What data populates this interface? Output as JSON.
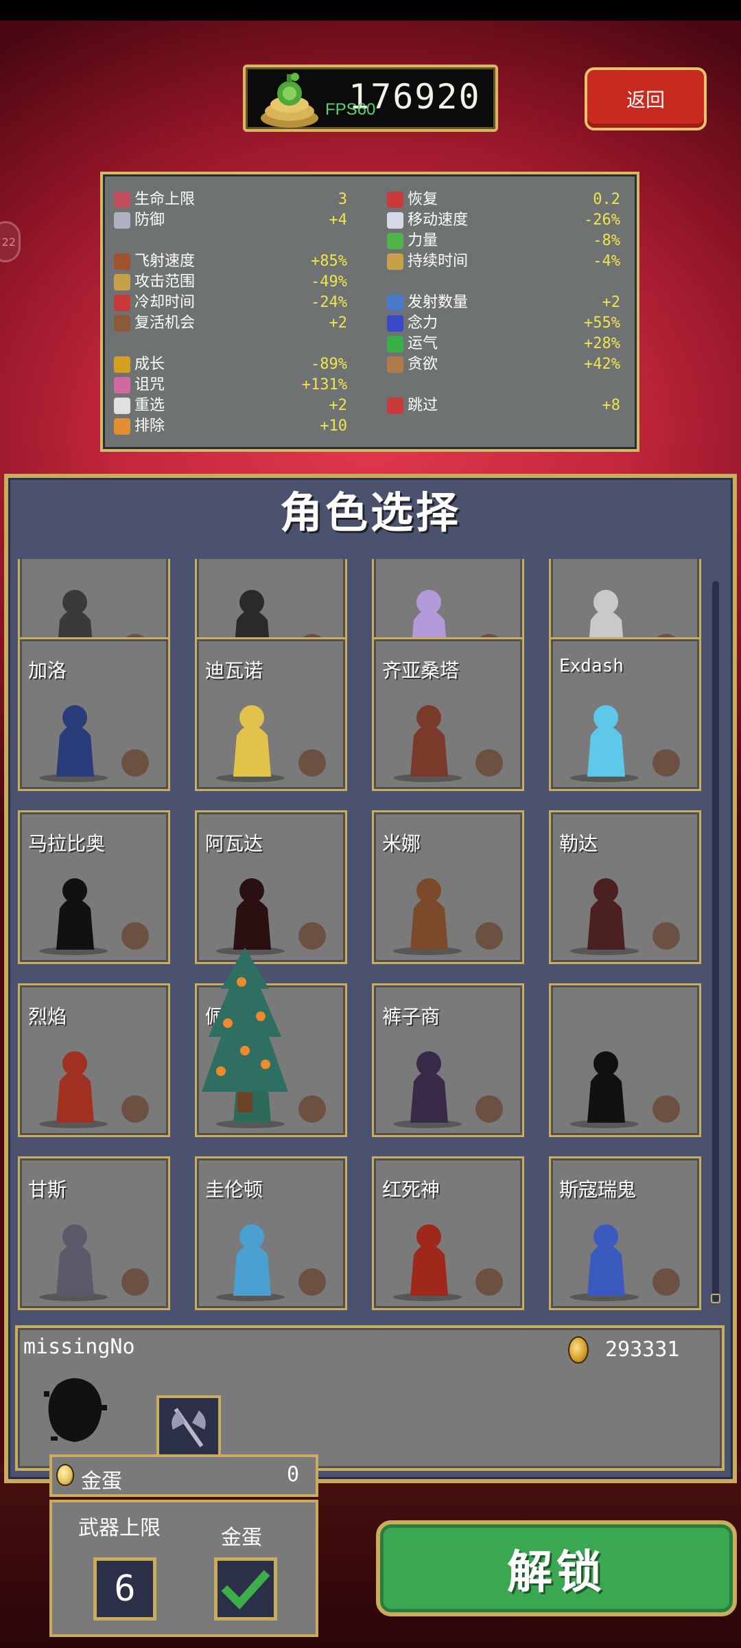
{
  "header": {
    "coins": "176920",
    "fps": "FPS60",
    "back_label": "返回",
    "side_tab": "22"
  },
  "stats": {
    "left": [
      {
        "label": "生命上限",
        "value": "3",
        "icon": "heart-icon"
      },
      {
        "label": "防御",
        "value": "+4",
        "icon": "armor-icon"
      },
      {
        "label": "飞射速度",
        "value": "+85%",
        "icon": "speed-icon"
      },
      {
        "label": "攻击范围",
        "value": "-49%",
        "icon": "area-icon"
      },
      {
        "label": "冷却时间",
        "value": "-24%",
        "icon": "cooldown-icon"
      },
      {
        "label": "复活机会",
        "value": "+2",
        "icon": "revival-icon"
      },
      {
        "label": "成长",
        "value": "-89%",
        "icon": "growth-icon"
      },
      {
        "label": "诅咒",
        "value": "+131%",
        "icon": "curse-icon"
      },
      {
        "label": "重选",
        "value": "+2",
        "icon": "reroll-icon"
      },
      {
        "label": "排除",
        "value": "+10",
        "icon": "banish-icon"
      }
    ],
    "right": [
      {
        "label": "恢复",
        "value": "0.2",
        "icon": "recovery-icon"
      },
      {
        "label": "移动速度",
        "value": "-26%",
        "icon": "wing-icon"
      },
      {
        "label": "力量",
        "value": "-8%",
        "icon": "might-icon"
      },
      {
        "label": "持续时间",
        "value": "-4%",
        "icon": "duration-icon"
      },
      {
        "label": "发射数量",
        "value": "+2",
        "icon": "amount-icon"
      },
      {
        "label": "念力",
        "value": "+55%",
        "icon": "magnet-icon"
      },
      {
        "label": "运气",
        "value": "+28%",
        "icon": "luck-icon"
      },
      {
        "label": "贪欲",
        "value": "+42%",
        "icon": "greed-icon"
      },
      {
        "label": "跳过",
        "value": "+8",
        "icon": "skip-icon"
      }
    ]
  },
  "selection": {
    "title": "角色选择",
    "rows": [
      [
        "",
        "",
        "",
        ""
      ],
      [
        "加洛",
        "迪瓦诺",
        "齐亚桑塔",
        "Exdash"
      ],
      [
        "马拉比奥",
        "阿瓦达",
        "米娜",
        "勒达"
      ],
      [
        "烈焰",
        "佩皮诺",
        "裤子商",
        ""
      ],
      [
        "甘斯",
        "圭伦顿",
        "红死神",
        "斯寇瑞鬼"
      ]
    ]
  },
  "selected": {
    "name": "missingNo",
    "gold": "293331"
  },
  "controls": {
    "egg_label": "金蛋",
    "egg_count": "0",
    "weapon_limit_label": "武器上限",
    "weapon_limit_value": "6",
    "gold_egg_label": "金蛋",
    "unlock_label": "解锁"
  },
  "colors": {
    "gold_border": "#c9ad5f",
    "stat_value": "#f2e54a",
    "panel_bg": "#4a5270",
    "unlock_green": "#3aa852",
    "back_red": "#c82a1d"
  }
}
